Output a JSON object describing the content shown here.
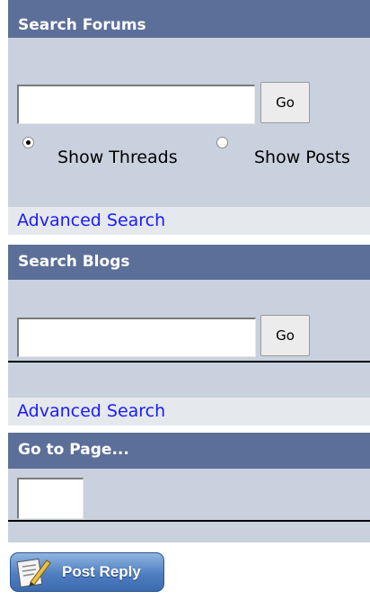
{
  "search_forums": {
    "title": "Search Forums",
    "input_value": "",
    "go_label": "Go",
    "radio_threads_label": "Show Threads",
    "radio_posts_label": "Show Posts",
    "selected": "threads",
    "advanced_link": "Advanced Search"
  },
  "search_blogs": {
    "title": "Search Blogs",
    "input_value": "",
    "go_label": "Go",
    "advanced_link": "Advanced Search"
  },
  "goto_page": {
    "title": "Go to Page...",
    "input_value": ""
  },
  "post_reply": {
    "label": "Post Reply",
    "icon": "paper-pen-icon"
  },
  "colors": {
    "header_bg": "#5c6f99",
    "panel_bg": "#c8d1dd",
    "link_bg": "#e5e9ee",
    "link_color": "#1a1aff"
  }
}
